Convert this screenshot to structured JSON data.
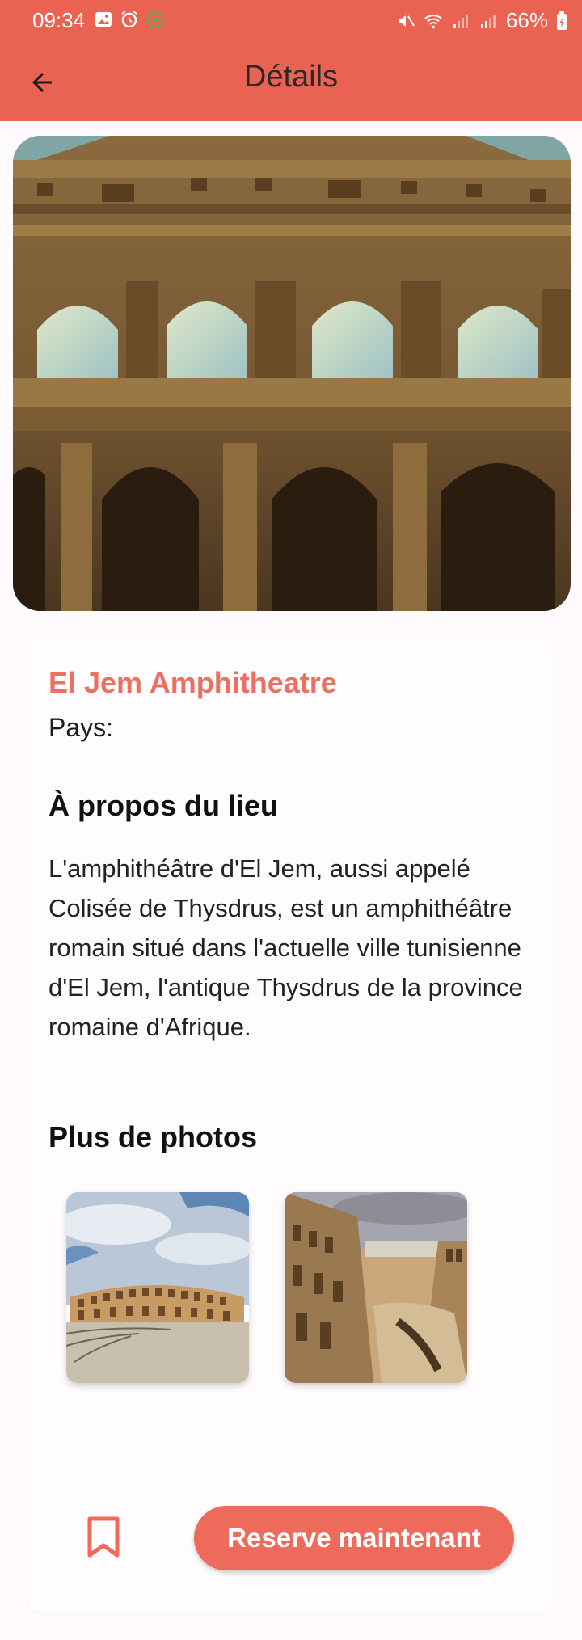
{
  "status_bar": {
    "time": "09:34",
    "battery": "66%"
  },
  "app_bar": {
    "title": "Détails",
    "back_icon": "arrow-back-icon"
  },
  "place": {
    "name": "El Jem Amphitheatre",
    "country_label": "Pays:",
    "about_heading": "À propos du lieu",
    "about_text": "L'amphithéâtre d'El Jem, aussi appelé Colisée de Thysdrus, est un amphithéâtre romain situé dans l'actuelle ville tunisienne d'El Jem, l'antique Thysdrus de la province romaine d'Afrique.",
    "photos_heading": "Plus de photos"
  },
  "actions": {
    "bookmark_icon": "bookmark-icon",
    "reserve_label": "Reserve maintenant"
  },
  "colors": {
    "accent": "#ea6352",
    "title": "#ec7062",
    "button": "#ee6b5c"
  }
}
